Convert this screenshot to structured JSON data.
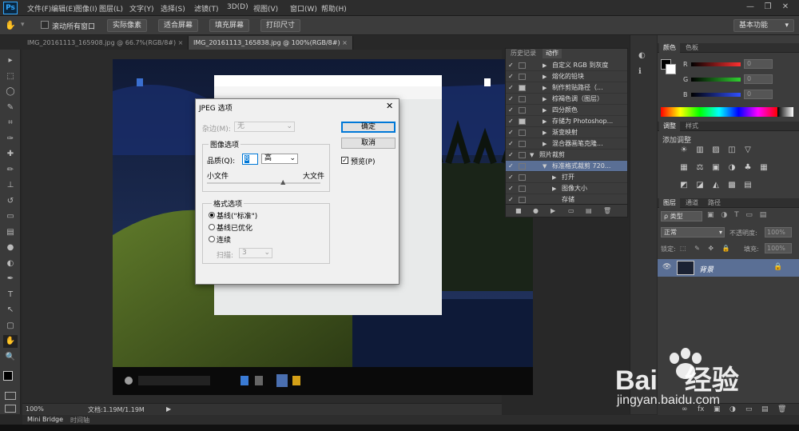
{
  "app": {
    "logo": "Ps",
    "window_controls": [
      "—",
      "❐",
      "✕"
    ]
  },
  "menubar": {
    "items": [
      "文件(F)",
      "编辑(E)",
      "图像(I)",
      "图层(L)",
      "文字(Y)",
      "选择(S)",
      "滤镜(T)",
      "3D(D)",
      "视图(V)",
      "窗口(W)",
      "帮助(H)"
    ]
  },
  "options": {
    "checkbox_label": "滚动所有窗口",
    "buttons": [
      "实际像素",
      "适合屏幕",
      "填充屏幕",
      "打印尺寸"
    ],
    "workspace": "基本功能"
  },
  "tabs": [
    {
      "label": "IMG_20161113_165908.jpg @ 66.7%(RGB/8#)",
      "active": false
    },
    {
      "label": "IMG_20161113_165838.jpg @ 100%(RGB/8#)",
      "active": true
    }
  ],
  "tools": [
    "move-icon",
    "marquee-icon",
    "lasso-icon",
    "quick-select-icon",
    "crop-icon",
    "eyedropper-icon",
    "healing-icon",
    "brush-icon",
    "stamp-icon",
    "history-brush-icon",
    "eraser-icon",
    "gradient-icon",
    "blur-icon",
    "dodge-icon",
    "pen-icon",
    "type-icon",
    "path-select-icon",
    "shape-icon",
    "hand-icon",
    "zoom-icon"
  ],
  "tool_glyphs": [
    "▸",
    "⬚",
    "◯",
    "✎",
    "⌗",
    "✑",
    "✚",
    "✏",
    "⊥",
    "↺",
    "▭",
    "▤",
    "●",
    "◐",
    "✒",
    "T",
    "↖",
    "▢",
    "✋",
    "🔍"
  ],
  "status": {
    "zoom": "100%",
    "doc": "文档:1.19M/1.19M",
    "arrow": "▶"
  },
  "bridge": {
    "items": [
      "Mini Bridge",
      "时间轴"
    ]
  },
  "history_panel": {
    "tabs": [
      "历史记录",
      "动作"
    ],
    "rows": [
      {
        "label": "自定义 RGB 到灰度",
        "check": "✓",
        "dialog": false,
        "tri": "▶",
        "indent": 0,
        "selected": false
      },
      {
        "label": "熔化的铅块",
        "check": "✓",
        "dialog": false,
        "tri": "▶",
        "indent": 0,
        "selected": false
      },
      {
        "label": "制作剪贴路径（...",
        "check": "✓",
        "dialog": true,
        "tri": "▶",
        "indent": 0,
        "selected": false
      },
      {
        "label": "棕褐色调（图层）",
        "check": "✓",
        "dialog": false,
        "tri": "▶",
        "indent": 0,
        "selected": false
      },
      {
        "label": "四分颜色",
        "check": "✓",
        "dialog": false,
        "tri": "▶",
        "indent": 0,
        "selected": false
      },
      {
        "label": "存储为 Photoshop...",
        "check": "✓",
        "dialog": true,
        "tri": "▶",
        "indent": 0,
        "selected": false
      },
      {
        "label": "渐变映射",
        "check": "✓",
        "dialog": false,
        "tri": "▶",
        "indent": 0,
        "selected": false
      },
      {
        "label": "混合器画笔克隆...",
        "check": "✓",
        "dialog": false,
        "tri": "▶",
        "indent": 0,
        "selected": false
      },
      {
        "label": "照片裁剪",
        "check": "✓",
        "dialog": false,
        "tri": "▼",
        "indent": -16,
        "selected": false
      },
      {
        "label": "标准格式裁剪 720...",
        "check": "✓",
        "dialog": false,
        "tri": "▼",
        "indent": 0,
        "selected": true
      },
      {
        "label": "打开",
        "check": "✓",
        "dialog": false,
        "tri": "▶",
        "indent": 12,
        "selected": false
      },
      {
        "label": "图像大小",
        "check": "✓",
        "dialog": false,
        "tri": "▶",
        "indent": 12,
        "selected": false
      },
      {
        "label": "存储",
        "check": "✓",
        "dialog": false,
        "tri": "",
        "indent": 12,
        "selected": false
      }
    ],
    "footer_icons": [
      "■",
      "●",
      "▶",
      "▭",
      "▤",
      "🗑"
    ]
  },
  "color_panel": {
    "tabs": [
      "颜色",
      "色板"
    ],
    "channels": [
      {
        "label": "R",
        "value": "0",
        "color": "#ff3030"
      },
      {
        "label": "G",
        "value": "0",
        "color": "#30d030"
      },
      {
        "label": "B",
        "value": "0",
        "color": "#3050ff"
      }
    ]
  },
  "adjust_panel": {
    "tabs": [
      "调整",
      "样式"
    ],
    "title": "添加调整",
    "row1": [
      "☀",
      "▥",
      "▨",
      "◫",
      "▽"
    ],
    "row2": [
      "▦",
      "⚖",
      "▣",
      "◑",
      "♣",
      "▦"
    ],
    "row3": [
      "◩",
      "◪",
      "◭",
      "▩",
      "▤"
    ]
  },
  "layers_panel": {
    "tabs": [
      "图层",
      "通道",
      "路径"
    ],
    "filter_label": "ρ 类型",
    "blend_mode": "正常",
    "opacity_label": "不透明度:",
    "opacity_value": "100%",
    "lock_label": "锁定:",
    "fill_label": "填充:",
    "fill_value": "100%",
    "layer_name": "背景",
    "footer_icons": [
      "∞",
      "fx",
      "▣",
      "◑",
      "▭",
      "▤",
      "🗑"
    ]
  },
  "dialog": {
    "title": "JPEG 选项",
    "matte_label": "杂边(M):",
    "matte_value": "无",
    "ok": "确定",
    "cancel": "取消",
    "preview_label": "预览(P)",
    "image_options_title": "图像选项",
    "quality_label": "品质(Q):",
    "quality_value": "8",
    "quality_preset": "高",
    "small_file": "小文件",
    "large_file": "大文件",
    "quality_level": 0.67,
    "format_options_title": "格式选项",
    "format_options": [
      "基线(\"标准\")",
      "基线已优化",
      "连续"
    ],
    "scan_label": "扫描:",
    "scan_value": "3"
  },
  "watermark": {
    "text": "Bai",
    "text2": "经验",
    "url": "jingyan.baidu.com"
  }
}
